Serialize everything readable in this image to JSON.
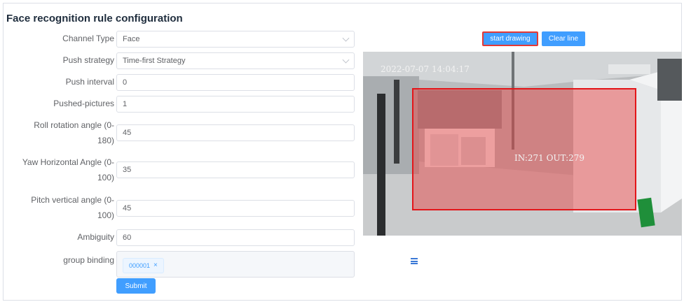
{
  "page_title": "Face recognition rule configuration",
  "form": {
    "channel_type": {
      "label": "Channel Type",
      "value": "Face"
    },
    "push_strategy": {
      "label": "Push strategy",
      "value": "Time-first Strategy"
    },
    "push_interval": {
      "label": "Push interval",
      "value": "0"
    },
    "pushed_pictures": {
      "label": "Pushed-pictures",
      "value": "1"
    },
    "roll_angle": {
      "label_line1": "Roll rotation angle (0-",
      "label_line2": "180)",
      "value": "45"
    },
    "yaw_angle": {
      "label_line1": "Yaw Horizontal Angle (0-",
      "label_line2": "100)",
      "value": "35"
    },
    "pitch_angle": {
      "label_line1": "Pitch vertical angle (0-",
      "label_line2": "100)",
      "value": "45"
    },
    "ambiguity": {
      "label": "Ambiguity",
      "value": "60"
    },
    "group_binding": {
      "label": "group binding",
      "tag": "000001",
      "tag_close": "×"
    },
    "submit_label": "Submit"
  },
  "drawing_toolbar": {
    "start_drawing_label": "start drawing",
    "clear_line_label": "Clear line"
  },
  "camera_view": {
    "timestamp": "2022-07-07 14:04:17",
    "counter": "IN:271 OUT:279"
  },
  "colors": {
    "primary": "#409eff",
    "highlight_border": "#e53935",
    "roi_border": "#e3161a"
  }
}
